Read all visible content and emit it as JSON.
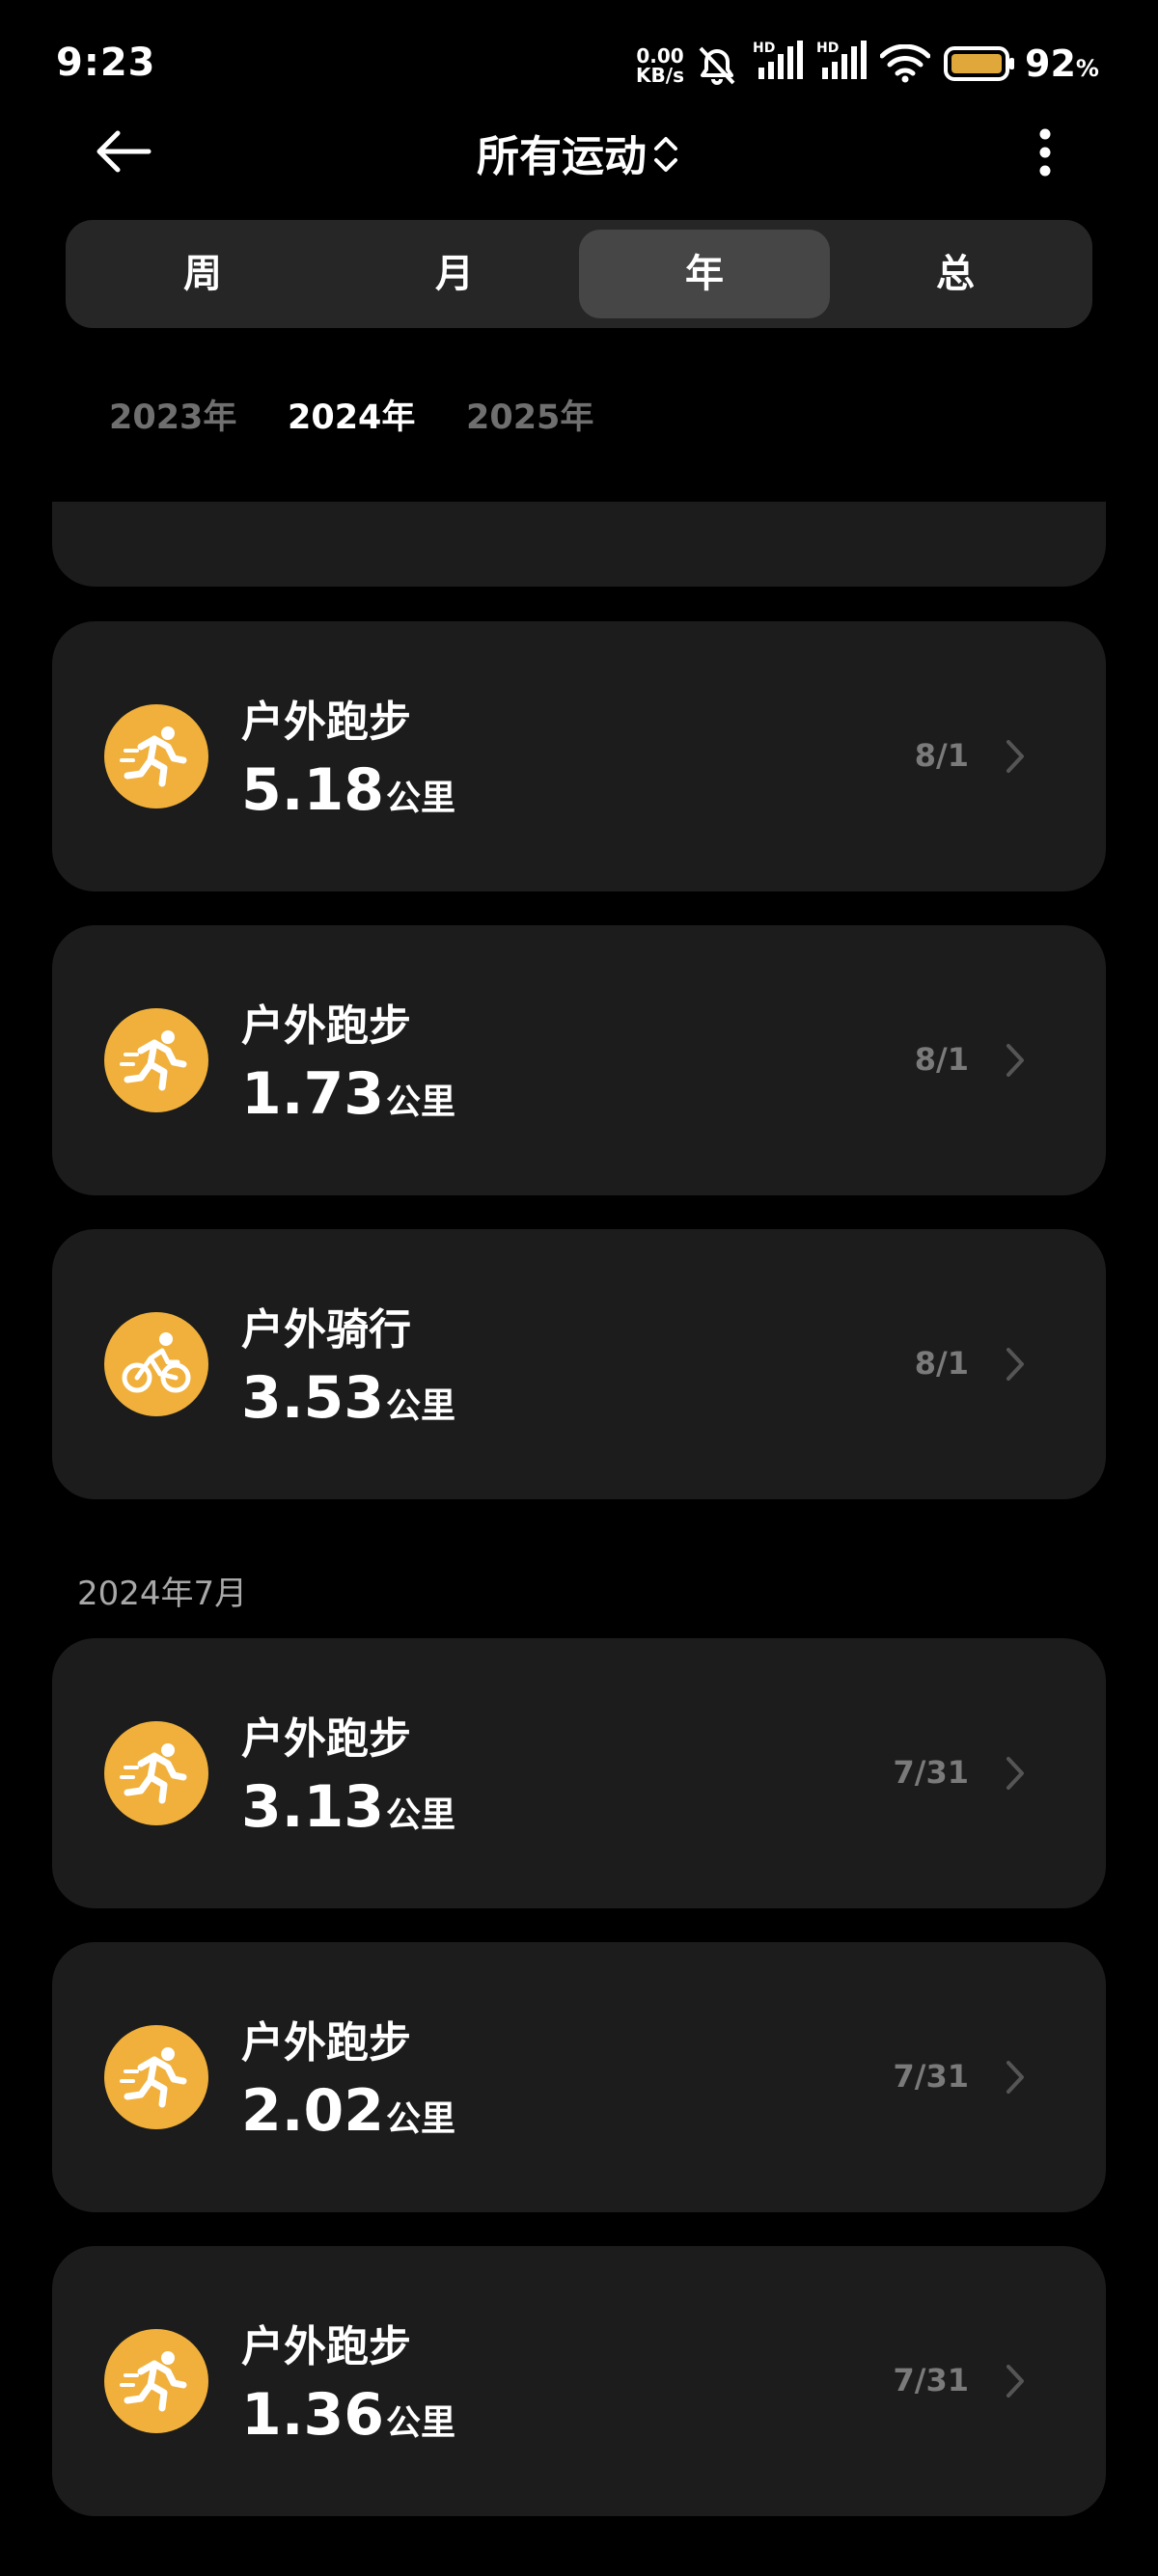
{
  "status_bar": {
    "time": "9:23",
    "net_speed_value": "0.00",
    "net_speed_unit": "KB/s",
    "battery_percent": "92",
    "battery_percent_sign": "%",
    "icons": [
      "mute-bell-icon",
      "hd-signal-icon",
      "hd-signal-icon",
      "wifi-icon",
      "battery-icon"
    ]
  },
  "header": {
    "back_icon": "arrow-left-icon",
    "title": "所有运动",
    "title_icon": "chevron-updown-icon",
    "menu_icon": "more-vertical-icon"
  },
  "period_tabs": [
    "周",
    "月",
    "年",
    "总"
  ],
  "period_active": "年",
  "year_tabs": [
    "2023年",
    "2024年",
    "2025年"
  ],
  "year_active": "2024年",
  "accent_color": "#f0b03b",
  "activities_aug": [
    {
      "name": "户外跑步",
      "distance": "5.18",
      "unit": "公里",
      "date": "8/1",
      "icon": "running-icon"
    },
    {
      "name": "户外跑步",
      "distance": "1.73",
      "unit": "公里",
      "date": "8/1",
      "icon": "running-icon"
    },
    {
      "name": "户外骑行",
      "distance": "3.53",
      "unit": "公里",
      "date": "8/1",
      "icon": "cycling-icon"
    }
  ],
  "section_july": "2024年7月",
  "activities_jul": [
    {
      "name": "户外跑步",
      "distance": "3.13",
      "unit": "公里",
      "date": "7/31",
      "icon": "running-icon"
    },
    {
      "name": "户外跑步",
      "distance": "2.02",
      "unit": "公里",
      "date": "7/31",
      "icon": "running-icon"
    },
    {
      "name": "户外跑步",
      "distance": "1.36",
      "unit": "公里",
      "date": "7/31",
      "icon": "running-icon"
    }
  ]
}
